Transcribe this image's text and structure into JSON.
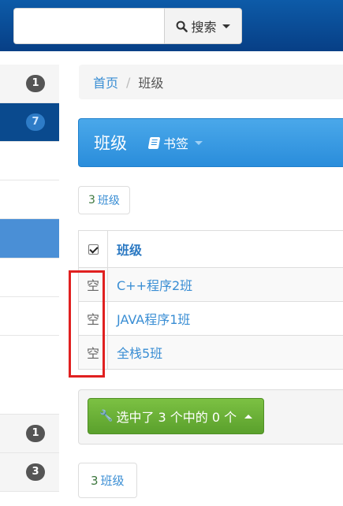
{
  "search": {
    "button_label": "搜索"
  },
  "sidebar": {
    "badges": [
      "1",
      "7",
      "1",
      "3"
    ]
  },
  "breadcrumb": {
    "home": "首页",
    "separator": "/",
    "current": "班级"
  },
  "header": {
    "title": "班级",
    "bookmark_label": "书签"
  },
  "count_top": {
    "num": "3",
    "label": "班级"
  },
  "table": {
    "header": "班级",
    "rows": [
      {
        "check": "空",
        "name": "C++程序2班"
      },
      {
        "check": "空",
        "name": "JAVA程序1班"
      },
      {
        "check": "空",
        "name": "全栈5班"
      }
    ]
  },
  "action": {
    "label": "选中了 3 个中的 0 个"
  },
  "count_bottom": {
    "num": "3",
    "label": "班级"
  },
  "colors": {
    "topbar": "#073f86",
    "accent": "#2a8ddb",
    "success": "#5aa02c",
    "highlight": "#e02020"
  }
}
